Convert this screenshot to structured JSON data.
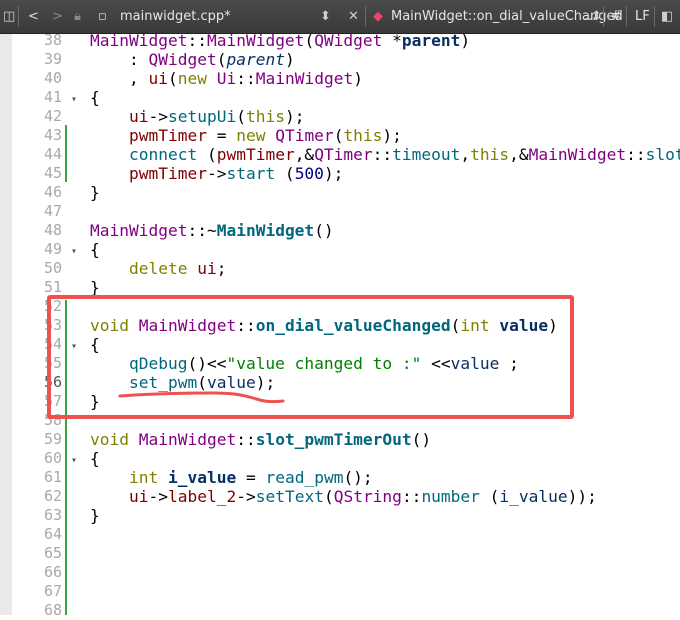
{
  "toolbar": {
    "file_name": "mainwidget.cpp*",
    "function_name": "MainWidget::on_dial_valueChanged",
    "function_suffix": "...",
    "hash_label": "#",
    "line_ending": "LF",
    "nav_back": "<",
    "nav_forward": ">"
  },
  "gutter": {
    "line_numbers": [
      "38",
      "39",
      "40",
      "41",
      "42",
      "43",
      "44",
      "45",
      "46",
      "47",
      "48",
      "49",
      "50",
      "51",
      "52",
      "53",
      "54",
      "55",
      "56",
      "57",
      "58",
      "59",
      "60",
      "61",
      "62",
      "63",
      "64",
      "65",
      "66",
      "67",
      "68"
    ],
    "current_line": "56"
  },
  "code": {
    "l38": {
      "a": "MainWidget",
      "b": "::",
      "c": "MainWidget",
      "d": "(",
      "e": "QWidget",
      "f": " *",
      "g": "parent",
      "h": ")"
    },
    "l39": {
      "a": "    : ",
      "b": "QWidget",
      "c": "(",
      "d": "parent",
      "e": ")"
    },
    "l40": {
      "a": "    , ",
      "b": "ui",
      "c": "(",
      "d": "new",
      "e": " ",
      "f": "Ui",
      "g": "::",
      "h": "MainWidget",
      "i": ")"
    },
    "l41": {
      "a": "{"
    },
    "l42": {
      "a": "    ",
      "b": "ui",
      "c": "->",
      "d": "setupUi",
      "e": "(",
      "f": "this",
      "g": ");"
    },
    "l43": {
      "a": "    ",
      "b": "pwmTimer",
      "c": " = ",
      "d": "new",
      "e": " ",
      "f": "QTimer",
      "g": "(",
      "h": "this",
      "i": ");"
    },
    "l44": {
      "a": "    ",
      "b": "connect",
      "c": " (",
      "d": "pwmTimer",
      "e": ",&",
      "f": "QTimer",
      "g": "::",
      "h": "timeout",
      "i": ",",
      "j": "this",
      "k": ",&",
      "l": "MainWidget",
      "m": "::",
      "n": "slot_"
    },
    "l45": {
      "a": "    ",
      "b": "pwmTimer",
      "c": "->",
      "d": "start",
      "e": " (",
      "f": "500",
      "g": ");"
    },
    "l46": {
      "a": "}"
    },
    "l48": {
      "a": "MainWidget",
      "b": "::~",
      "c": "MainWidget",
      "d": "()"
    },
    "l49": {
      "a": "{"
    },
    "l50": {
      "a": "    ",
      "b": "delete",
      "c": " ",
      "d": "ui",
      "e": ";"
    },
    "l51": {
      "a": "}"
    },
    "l53": {
      "a": "void",
      "b": " ",
      "c": "MainWidget",
      "d": "::",
      "e": "on_dial_valueChanged",
      "f": "(",
      "g": "int",
      "h": " ",
      "i": "value",
      "j": ")"
    },
    "l54": {
      "a": "{"
    },
    "l55": {
      "a": "    ",
      "b": "qDebug",
      "c": "()<<",
      "d": "\"value changed to :\"",
      "e": " <<",
      "f": "value",
      "g": " ;"
    },
    "l56": {
      "a": "    ",
      "b": "set_pwm",
      "c": "(",
      "d": "value",
      "e": ");"
    },
    "l57": {
      "a": "}"
    },
    "l59": {
      "a": "void",
      "b": " ",
      "c": "MainWidget",
      "d": "::",
      "e": "slot_pwmTimerOut",
      "f": "()"
    },
    "l60": {
      "a": "{"
    },
    "l61": {
      "a": "    ",
      "b": "int",
      "c": " ",
      "d": "i_value",
      "e": " = ",
      "f": "read_pwm",
      "g": "();"
    },
    "l62": {
      "a": "    ",
      "b": "ui",
      "c": "->",
      "d": "label_2",
      "e": "->",
      "f": "setText",
      "g": "(",
      "h": "QString",
      "i": "::",
      "j": "number",
      "k": " (",
      "l": "i_value",
      "m": "));"
    },
    "l63": {
      "a": "}"
    }
  },
  "colors": {
    "annotation": "#ef5050",
    "changebar": "#3aa33a",
    "toolbar_bg": "#3f3f3f"
  }
}
